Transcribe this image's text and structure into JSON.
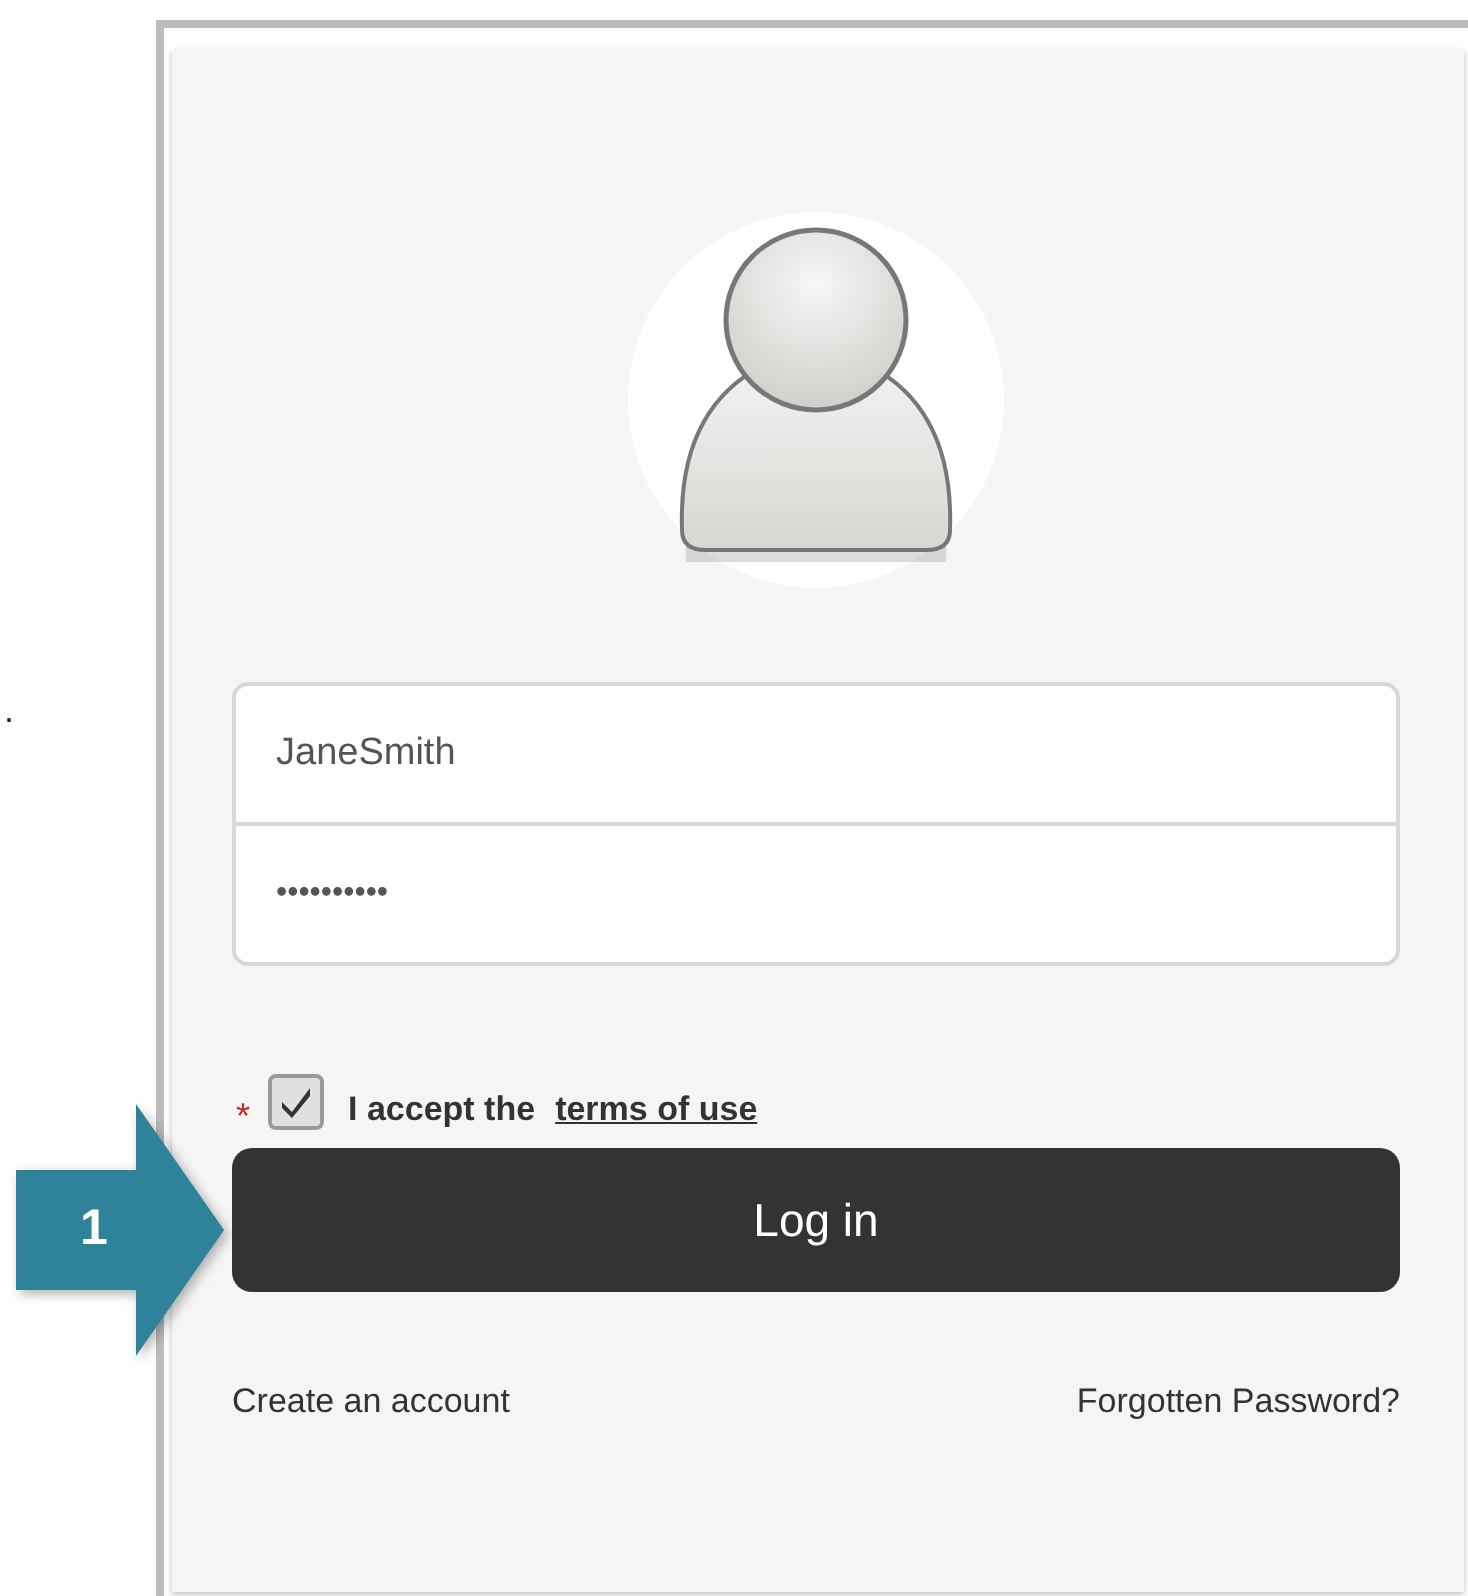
{
  "margin_mark": ".",
  "username": {
    "value": "JaneSmith"
  },
  "password": {
    "value": "••••••••••"
  },
  "terms": {
    "required_mark": "*",
    "checked": true,
    "label": "I accept the",
    "link": "terms of use"
  },
  "login_button": "Log in",
  "links": [
    "Create an account",
    "Forgotten Password?"
  ],
  "callout": {
    "number": "1"
  }
}
